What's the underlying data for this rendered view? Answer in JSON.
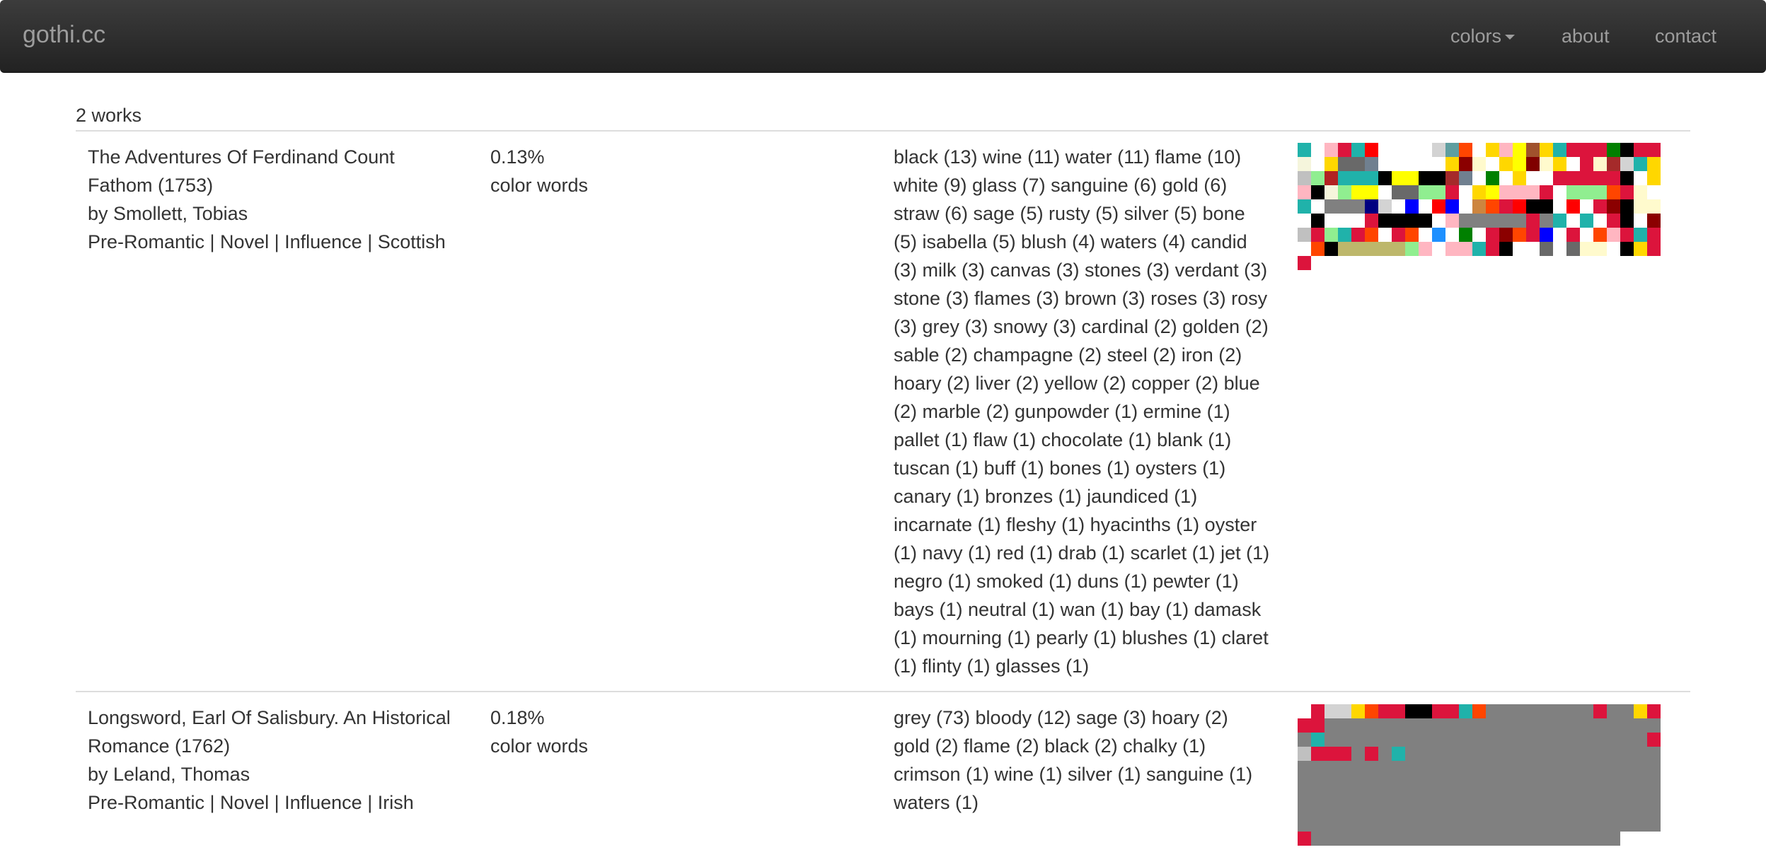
{
  "navbar": {
    "brand": "gothi.cc",
    "colors_label": "colors",
    "about_label": "about",
    "contact_label": "contact"
  },
  "works_count": "2 works",
  "works": [
    {
      "title_lines": [
        "The Adventures Of Ferdinand Count",
        "Fathom (1753)"
      ],
      "author": "by Smollett, Tobias",
      "tags": "Pre-Romantic | Novel | Influence | Scottish",
      "percent": "0.13%",
      "percent_label": "color words",
      "word_lines": [
        "black (13) wine (11) water (11) flame (10)",
        "white (9) glass (7) sanguine (6) gold (6)",
        "straw (6) sage (5) rusty (5) silver (5) bone",
        "(5) isabella (5) blush (4) waters (4) candid",
        "(3) milk (3) canvas (3) stones (3) verdant (3)",
        "stone (3) flames (3) brown (3) roses (3) rosy",
        "(3) grey (3) snowy (3) cardinal (2) golden (2)",
        "sable (2) champagne (2) steel (2) iron (2)",
        "hoary (2) liver (2) yellow (2) copper (2) blue",
        "(2) marble (2) gunpowder (1) ermine (1)",
        "pallet (1) flaw (1) chocolate (1) blank (1)",
        "tuscan (1) buff (1) bones (1) oysters (1)",
        "canary (1) bronzes (1) jaundiced (1)",
        "incarnate (1) fleshy (1) hyacinths (1) oyster",
        "(1) navy (1) red (1) drab (1) scarlet (1) jet (1)",
        "negro (1) smoked (1) duns (1) pewter (1)",
        "bays (1) neutral (1) wan (1) bay (1) damask",
        "(1) mourning (1) pearly (1) blushes (1) claret",
        "(1) flinty (1) glasses (1)"
      ],
      "swatch_rows": [
        [
          "#20b2aa",
          "#ffffff",
          "#ffb6c1",
          "#dc143c",
          "#20b2aa",
          "#ff0000",
          "#ffffff",
          "#ffffff",
          "#ffffff",
          "#ffffff",
          "#d3d3d3",
          "#5f9ea0",
          "#ff4500",
          "#ffffff",
          "#ffd700",
          "#ffb6c1",
          "#ffff00",
          "#a0522d",
          "#ffd700",
          "#20b2aa",
          "#dc143c",
          "#dc143c",
          "#dc143c",
          "#008000",
          "#000000",
          "#dc143c",
          "#dc143c"
        ],
        [
          "#f5f5dc",
          "#ffffff",
          "#ffd700",
          "#696969",
          "#696969",
          "#708090",
          "#ffffff",
          "#ffffff",
          "#ffffff",
          "#ffffff",
          "#ffffff",
          "#ffd700",
          "#8b0000",
          "#fffacd",
          "#ffffff",
          "#ffd700",
          "#ffff00",
          "#800000",
          "#fffacd",
          "#ffd700",
          "#ffffff",
          "#dc143c",
          "#fffacd",
          "#a52a2a",
          "#d3d3d3",
          "#20b2aa",
          "#ffd700"
        ],
        [
          "#c0c0c0",
          "#90ee90",
          "#b22222",
          "#20b2aa",
          "#20b2aa",
          "#20b2aa",
          "#000000",
          "#ffff00",
          "#ffff00",
          "#000000",
          "#000000",
          "#a52a2a",
          "#708090",
          "#ffffff",
          "#008000",
          "#ffffff",
          "#ffd700",
          "#ffffff",
          "#ffffff",
          "#dc143c",
          "#dc143c",
          "#dc143c",
          "#dc143c",
          "#dc143c",
          "#000000",
          "#ffffff",
          "#ffd700"
        ],
        [
          "#ffb6c1",
          "#000000",
          "#f5f5dc",
          "#90ee90",
          "#ffff00",
          "#ffff00",
          "#ffffff",
          "#696969",
          "#696969",
          "#90ee90",
          "#90ee90",
          "#dc143c",
          "#ffffff",
          "#ffd700",
          "#ffff00",
          "#ffb6c1",
          "#ffb6c1",
          "#ffb6c1",
          "#dc143c",
          "#ffffff",
          "#90ee90",
          "#90ee90",
          "#90ee90",
          "#ff4500",
          "#dc143c",
          "#fffacd",
          "#ffffff"
        ],
        [
          "#20b2aa",
          "#ffffff",
          "#808080",
          "#808080",
          "#808080",
          "#000080",
          "#d3d3d3",
          "#ffffff",
          "#0000ff",
          "#ffffff",
          "#ff0000",
          "#0000ff",
          "#ffffff",
          "#cd853f",
          "#ff4500",
          "#dc143c",
          "#ff0000",
          "#000000",
          "#000000",
          "#ffffff",
          "#ff0000",
          "#ffffff",
          "#dc143c",
          "#8b0000",
          "#000000",
          "#fffacd",
          "#fffacd"
        ],
        [
          "#ffffff",
          "#000000",
          "#ffffff",
          "#ffffff",
          "#ffffff",
          "#dc143c",
          "#000000",
          "#000000",
          "#000000",
          "#000000",
          "#ffffff",
          "#ffb6c1",
          "#808080",
          "#808080",
          "#808080",
          "#808080",
          "#808080",
          "#dc143c",
          "#808080",
          "#20b2aa",
          "#ffffff",
          "#20b2aa",
          "#ffffff",
          "#dc143c",
          "#000000",
          "#ffffff",
          "#8b0000"
        ],
        [
          "#c0c0c0",
          "#dc143c",
          "#90ee90",
          "#20b2aa",
          "#dc143c",
          "#ff4500",
          "#ffffff",
          "#dc143c",
          "#ff4500",
          "#ffffff",
          "#1e90ff",
          "#ffffff",
          "#008000",
          "#ffffff",
          "#dc143c",
          "#8b0000",
          "#ff4500",
          "#dc143c",
          "#0000ff",
          "#ffffff",
          "#dc143c",
          "#ffffff",
          "#ff4500",
          "#ffb6c1",
          "#dc143c",
          "#20b2aa",
          "#dc143c"
        ],
        [
          "#ffffff",
          "#ff4500",
          "#000000",
          "#bdb76b",
          "#bdb76b",
          "#bdb76b",
          "#bdb76b",
          "#bdb76b",
          "#90ee90",
          "#ffb6c1",
          "#ffffff",
          "#ffb6c1",
          "#ffb6c1",
          "#20b2aa",
          "#dc143c",
          "#000000",
          "#ffffff",
          "#ffffff",
          "#696969",
          "#ffffff",
          "#696969",
          "#fffacd",
          "#fffacd",
          "#ffffff",
          "#000000",
          "#ffd700",
          "#dc143c"
        ],
        [
          "#dc143c"
        ]
      ]
    },
    {
      "title_lines": [
        "Longsword, Earl Of Salisbury. An Historical",
        "Romance (1762)"
      ],
      "author": "by Leland, Thomas",
      "tags": "Pre-Romantic | Novel | Influence | Irish",
      "percent": "0.18%",
      "percent_label": "color words",
      "word_lines": [
        "grey (73) bloody (12) sage (3) hoary (2)",
        "gold (2) flame (2) black (2) chalky (1)",
        "crimson (1) wine (1) silver (1) sanguine (1)",
        "waters (1)"
      ],
      "swatch_rows": [
        [
          "#ffffff",
          "#dc143c",
          "#d3d3d3",
          "#d3d3d3",
          "#ffd700",
          "#ff4500",
          "#dc143c",
          "#dc143c",
          "#000000",
          "#000000",
          "#dc143c",
          "#dc143c",
          "#20b2aa",
          "#ff4500",
          "#808080",
          "#808080",
          "#808080",
          "#808080",
          "#808080",
          "#808080",
          "#808080",
          "#808080",
          "#dc143c",
          "#808080",
          "#808080",
          "#ffd700",
          "#dc143c",
          "#dc143c",
          "#dc143c"
        ],
        [
          "#808080",
          "#808080",
          "#808080",
          "#808080",
          "#808080",
          "#808080",
          "#808080",
          "#808080",
          "#808080",
          "#808080",
          "#808080",
          "#808080",
          "#808080",
          "#808080",
          "#808080",
          "#808080",
          "#808080",
          "#808080",
          "#808080",
          "#808080",
          "#808080",
          "#808080",
          "#808080",
          "#808080",
          "#808080",
          "#808080",
          "#20b2aa",
          "#808080",
          "#808080",
          "#808080"
        ],
        [
          "#808080",
          "#808080",
          "#808080",
          "#808080",
          "#808080",
          "#808080",
          "#808080",
          "#808080",
          "#808080",
          "#808080",
          "#808080",
          "#808080",
          "#808080",
          "#808080",
          "#808080",
          "#808080",
          "#808080",
          "#808080",
          "#808080",
          "#808080",
          "#808080",
          "#dc143c",
          "#c0c0c0",
          "#dc143c",
          "#dc143c",
          "#dc143c",
          "#808080",
          "#dc143c",
          "#808080",
          "#20b2aa",
          "#808080",
          "#808080",
          "#808080",
          "#808080",
          "#808080",
          "#808080",
          "#808080",
          "#808080",
          "#808080",
          "#808080",
          "#808080",
          "#808080",
          "#808080",
          "#808080",
          "#808080",
          "#808080"
        ],
        [
          "#808080",
          "#808080",
          "#808080",
          "#808080",
          "#808080",
          "#808080",
          "#808080",
          "#808080",
          "#808080",
          "#808080",
          "#808080",
          "#808080",
          "#808080",
          "#808080",
          "#808080",
          "#808080",
          "#808080",
          "#808080",
          "#808080",
          "#808080",
          "#808080",
          "#808080",
          "#808080",
          "#808080",
          "#808080",
          "#808080",
          "#808080",
          "#808080",
          "#808080",
          "#808080",
          "#808080",
          "#808080",
          "#808080",
          "#808080",
          "#808080",
          "#808080",
          "#808080",
          "#808080",
          "#808080",
          "#808080",
          "#808080",
          "#808080",
          "#808080",
          "#808080",
          "#808080",
          "#808080",
          "#808080",
          "#808080",
          "#808080",
          "#808080",
          "#808080",
          "#808080",
          "#808080",
          "#808080",
          "#808080",
          "#808080",
          "#808080",
          "#808080",
          "#808080",
          "#808080",
          "#808080",
          "#808080",
          "#808080",
          "#808080",
          "#808080",
          "#808080",
          "#808080",
          "#808080",
          "#808080",
          "#808080",
          "#808080",
          "#808080",
          "#808080",
          "#808080",
          "#808080",
          "#808080",
          "#808080",
          "#808080",
          "#808080",
          "#808080",
          "#808080",
          "#808080",
          "#808080",
          "#808080",
          "#808080",
          "#808080",
          "#808080",
          "#808080",
          "#808080",
          "#808080",
          "#808080",
          "#808080",
          "#808080",
          "#808080",
          "#808080",
          "#808080",
          "#808080",
          "#808080",
          "#808080",
          "#808080",
          "#808080",
          "#808080",
          "#808080",
          "#808080",
          "#808080",
          "#808080",
          "#808080",
          "#808080",
          "#808080",
          "#808080",
          "#808080",
          "#808080",
          "#808080",
          "#808080",
          "#808080",
          "#808080",
          "#808080",
          "#808080",
          "#808080",
          "#808080",
          "#808080",
          "#808080",
          "#808080",
          "#808080",
          "#808080",
          "#808080",
          "#808080",
          "#808080",
          "#808080",
          "#808080",
          "#808080",
          "#808080"
        ],
        [
          "#808080",
          "#808080",
          "#808080",
          "#808080",
          "#808080",
          "#808080",
          "#dc143c",
          "#808080",
          "#808080",
          "#808080",
          "#808080",
          "#808080",
          "#808080",
          "#808080",
          "#808080",
          "#808080",
          "#808080",
          "#808080",
          "#808080",
          "#808080",
          "#808080",
          "#808080",
          "#808080",
          "#808080",
          "#808080",
          "#808080",
          "#808080",
          "#808080",
          "#808080",
          "#808080"
        ]
      ]
    }
  ]
}
